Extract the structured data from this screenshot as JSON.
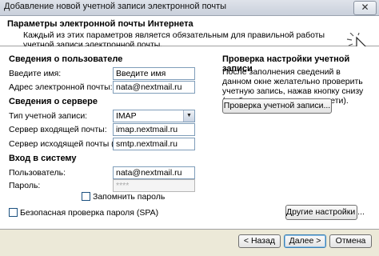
{
  "window": {
    "title": "Добавление новой учетной записи электронной почты",
    "close_glyph": "✕"
  },
  "header": {
    "title": "Параметры электронной почты Интернета",
    "description": "Каждый из этих параметров является обязательным для правильной работы учетной записи электронной почты."
  },
  "user_info": {
    "heading": "Сведения о пользователе",
    "name_label": "Введите имя:",
    "name_value": "Введите имя",
    "email_label": "Адрес электронной почты:",
    "email_value": "nata@nextmail.ru"
  },
  "server_info": {
    "heading": "Сведения о сервере",
    "account_type_label": "Тип учетной записи:",
    "account_type_value": "IMAP",
    "incoming_label": "Сервер входящей почты:",
    "incoming_value": "imap.nextmail.ru",
    "outgoing_label": "Сервер исходящей почты (SMTP):",
    "outgoing_value": "smtp.nextmail.ru"
  },
  "logon": {
    "heading": "Вход в систему",
    "user_label": "Пользователь:",
    "user_value": "nata@nextmail.ru",
    "password_label": "Пароль:",
    "password_value": "****",
    "remember_label": "Запомнить пароль",
    "spa_label": "Безопасная проверка пароля (SPA)"
  },
  "test": {
    "heading": "Проверка настройки учетной записи",
    "description": "После заполнения сведений в данном окне желательно проверить учетную запись, нажав кнопку снизу (требуется подключение к сети).",
    "button": "Проверка учетной записи..."
  },
  "more_settings_button": "Другие настройки ...",
  "footer": {
    "back": "< Назад",
    "next": "Далее >",
    "cancel": "Отмена"
  }
}
